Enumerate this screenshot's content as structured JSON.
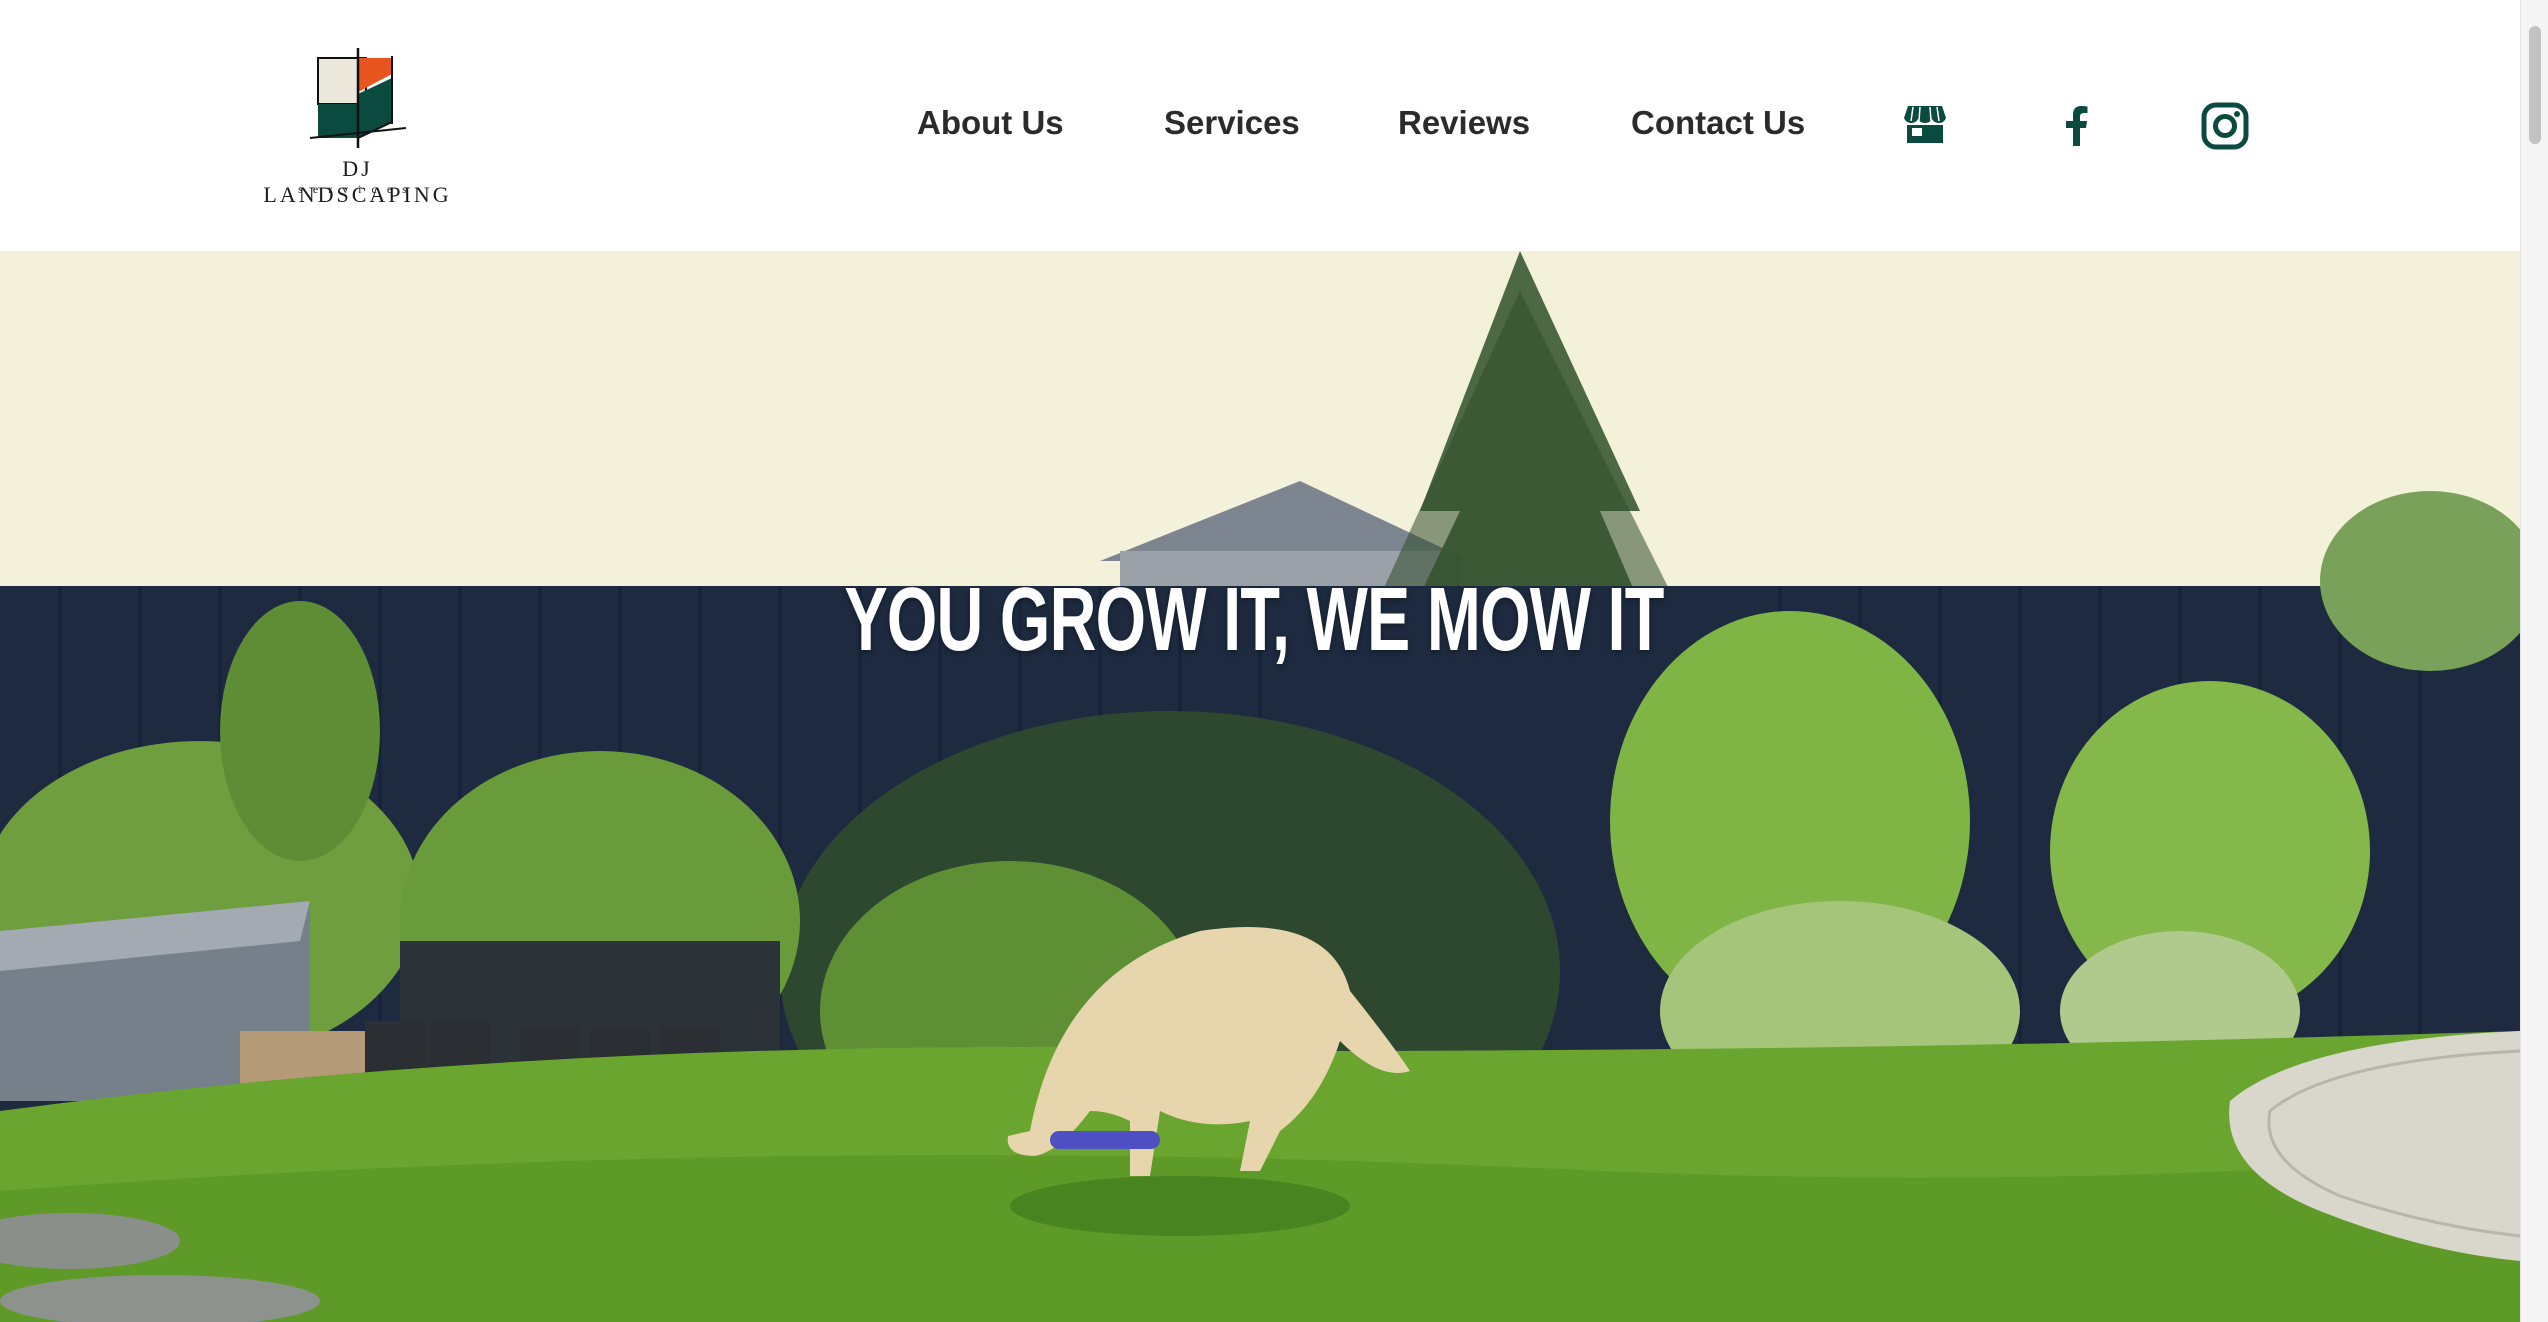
{
  "brand": {
    "name": "DJ LANDSCAPING",
    "tagline": "services"
  },
  "nav": {
    "items": [
      {
        "label": "About Us"
      },
      {
        "label": "Services"
      },
      {
        "label": "Reviews"
      },
      {
        "label": "Contact Us"
      }
    ],
    "icons": [
      "storefront-icon",
      "facebook-icon",
      "instagram-icon"
    ]
  },
  "hero": {
    "headline": "YOU GROW IT, WE MOW IT"
  },
  "colors": {
    "brand_green": "#0b4a3f",
    "logo_orange": "#e8551f",
    "nav_text": "#2b2b2b",
    "sky": "#f3f1da",
    "fence": "#1d2a3f",
    "grass": "#6aa530"
  }
}
